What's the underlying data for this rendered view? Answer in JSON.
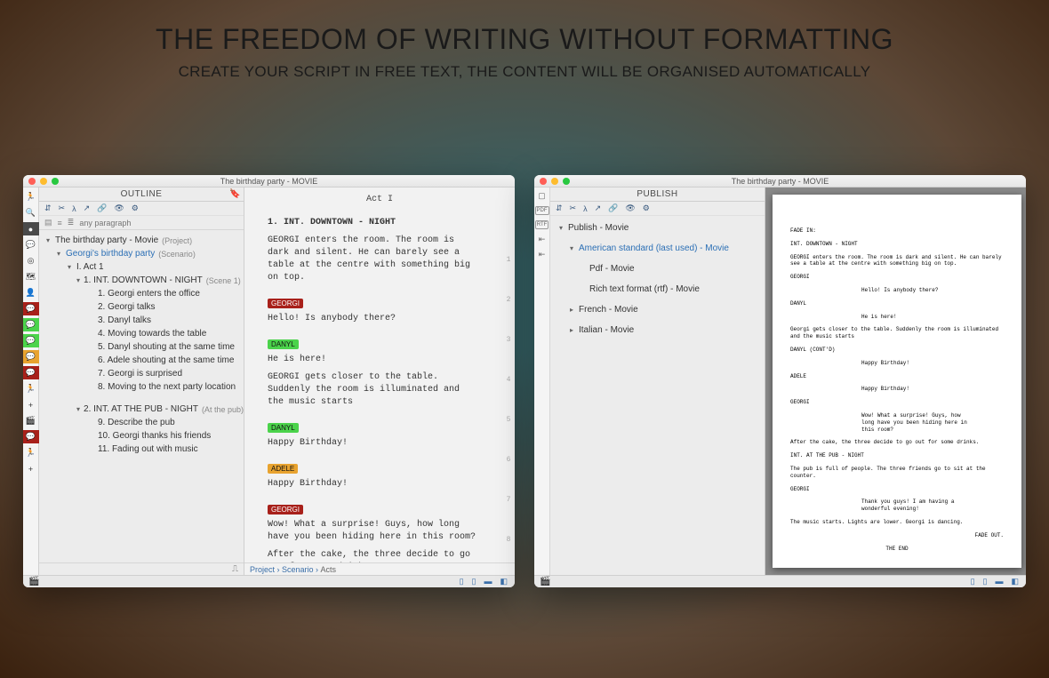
{
  "marketing": {
    "title": "THE FREEDOM OF WRITING WITHOUT FORMATTING",
    "subtitle": "CREATE YOUR SCRIPT IN FREE TEXT, THE CONTENT WILL BE ORGANISED AUTOMATICALLY"
  },
  "window1": {
    "title": "The birthday party - MOVIE",
    "outline_header": "OUTLINE",
    "toolbar_icons": [
      "hierarchy-icon",
      "cut-icon",
      "branch-icon",
      "share-icon",
      "link-icon",
      "eye-icon",
      "sliders-icon"
    ],
    "toolbar2": {
      "mode_icons": [
        "list-icon",
        "sort-icon",
        "filter-icon"
      ],
      "placeholder": "any paragraph"
    },
    "tree": [
      {
        "lvl": 0,
        "caret": "▾",
        "text": "The birthday party - Movie",
        "suffix": "(Project)"
      },
      {
        "lvl": 1,
        "caret": "▾",
        "text": "Georgi's birthday party",
        "suffix": "(Scenario)",
        "link": true
      },
      {
        "lvl": 2,
        "caret": "▾",
        "text": "I. Act 1",
        "suffix": ""
      },
      {
        "lvl": 3,
        "caret": "▾",
        "text": "1. INT.  DOWNTOWN - NIGHT",
        "suffix": "(Scene 1)"
      },
      {
        "lvl": 4,
        "caret": "",
        "text": "1. Georgi enters the office",
        "suffix": ""
      },
      {
        "lvl": 4,
        "caret": "",
        "text": "2. Georgi talks",
        "suffix": ""
      },
      {
        "lvl": 4,
        "caret": "",
        "text": "3. Danyl talks",
        "suffix": ""
      },
      {
        "lvl": 4,
        "caret": "",
        "text": "4. Moving towards the table",
        "suffix": ""
      },
      {
        "lvl": 4,
        "caret": "",
        "text": "5. Danyl shouting at the same time",
        "suffix": ""
      },
      {
        "lvl": 4,
        "caret": "",
        "text": "6. Adele shouting at the same time",
        "suffix": ""
      },
      {
        "lvl": 4,
        "caret": "",
        "text": "7. Georgi is surprised",
        "suffix": ""
      },
      {
        "lvl": 4,
        "caret": "",
        "text": "8. Moving to the next party location",
        "suffix": ""
      },
      {
        "lvl": 3,
        "caret": "▾",
        "text": "2. INT.  AT THE PUB - NIGHT",
        "suffix": "(At the pub)",
        "mt": 10
      },
      {
        "lvl": 4,
        "caret": "",
        "text": "9. Describe the pub",
        "suffix": ""
      },
      {
        "lvl": 4,
        "caret": "",
        "text": "10. Georgi thanks his friends",
        "suffix": ""
      },
      {
        "lvl": 4,
        "caret": "",
        "text": "11. Fading out with music",
        "suffix": ""
      }
    ],
    "footer_icon": "equalizer-icon",
    "script": {
      "act_heading": "Act I",
      "scene": "1. INT.  DOWNTOWN - NIGHT",
      "blocks": [
        {
          "type": "action",
          "text": "GEORGI enters the room. The room is dark and silent. He can barely see a table at the centre with something big on top."
        },
        {
          "type": "char",
          "name": "GEORGI",
          "cls": "tag-red"
        },
        {
          "type": "dialogue",
          "text": "Hello! Is anybody there?"
        },
        {
          "type": "char",
          "name": "DANYL",
          "cls": "tag-green"
        },
        {
          "type": "dialogue",
          "text": "He is here!"
        },
        {
          "type": "action",
          "text": "GEORGI gets closer to the table. Suddenly the room is illuminated and the music starts"
        },
        {
          "type": "char",
          "name": "DANYL",
          "cls": "tag-green"
        },
        {
          "type": "dialogue",
          "text": "Happy Birthday!"
        },
        {
          "type": "char",
          "name": "ADELE",
          "cls": "tag-orange"
        },
        {
          "type": "dialogue",
          "text": "Happy Birthday!"
        },
        {
          "type": "char",
          "name": "GEORGI",
          "cls": "tag-red"
        },
        {
          "type": "dialogue",
          "text": "Wow! What a surprise! Guys, how long have you been hiding here in this room?"
        },
        {
          "type": "action",
          "text": "After the cake, the three decide to go out for some drinks."
        }
      ],
      "gutter": [
        "1",
        "2",
        "3",
        "4",
        "5",
        "6",
        "7",
        "8"
      ]
    },
    "breadcrumb": [
      "Project",
      "Scenario",
      "Acts"
    ],
    "clapper": "🎬"
  },
  "window2": {
    "title": "The birthday party - MOVIE",
    "publish_header": "PUBLISH",
    "toolbar_icons": [
      "hierarchy-icon",
      "cut-icon",
      "branch-icon",
      "share-icon",
      "link-icon",
      "eye-icon",
      "sliders-icon"
    ],
    "rail_icons": [
      "book-icon",
      "pdf-icon",
      "rtf-icon",
      "export-icon",
      "export-icon"
    ],
    "tree": [
      {
        "lvl": 0,
        "caret": "▾",
        "text": "Publish - Movie",
        "suffix": ""
      },
      {
        "lvl": 1,
        "caret": "▾",
        "text": "American standard (last used) - Movie",
        "suffix": "",
        "link": true,
        "mt": 8
      },
      {
        "lvl": 2,
        "caret": "",
        "text": "Pdf - Movie",
        "suffix": "",
        "mt": 8
      },
      {
        "lvl": 2,
        "caret": "",
        "text": "Rich text format (rtf) - Movie",
        "suffix": "",
        "mt": 8
      },
      {
        "lvl": 1,
        "caret": "▸",
        "text": "French - Movie",
        "suffix": "",
        "mt": 8
      },
      {
        "lvl": 1,
        "caret": "▸",
        "text": "Italian - Movie",
        "suffix": "",
        "mt": 8
      }
    ],
    "paper": {
      "fade_in": "FADE IN:",
      "scene1": "INT. DOWNTOWN - NIGHT",
      "action1": "GEORGI enters the room. The room is dark and silent. He can barely see a table at the centre with something big on top.",
      "chars": [
        {
          "name": "GEORGI",
          "line": "Hello! Is anybody there?"
        },
        {
          "name": "DANYL",
          "line": "He is here!"
        }
      ],
      "action2": "Georgi gets closer to the table. Suddenly the room is illuminated and the music starts",
      "cont": "DANYL (CONT'D)",
      "cont_line": "Happy Birthday!",
      "adele": "ADELE",
      "adele_line": "Happy Birthday!",
      "georgi2": "GEORGI",
      "georgi2_line": "Wow! What a surprise! Guys, how long have you been hiding here in this room?",
      "action3": "After the cake, the three decide to go out for some drinks.",
      "scene2": "INT. AT THE PUB - NIGHT",
      "action4": "The pub is full of people. The three friends go to sit at the counter.",
      "georgi3": "GEORGI",
      "georgi3_line": "Thank you guys! I am having a wonderful evening!",
      "action5": "The music starts. Lights are lower. Georgi is dancing.",
      "fade_out": "FADE OUT.",
      "the_end": "THE END"
    },
    "clapper": "🎬"
  }
}
